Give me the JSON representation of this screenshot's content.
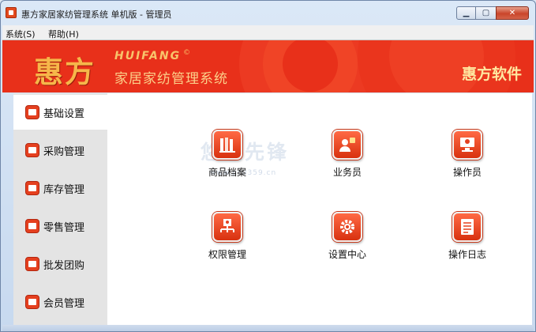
{
  "window": {
    "title": "惠方家居家纺管理系统 单机版 - 管理员",
    "controls": {
      "minimize": "▁",
      "maximize": "▢",
      "close": "✕"
    }
  },
  "menu": [
    {
      "label": "系统(S)"
    },
    {
      "label": "帮助(H)"
    }
  ],
  "banner": {
    "logo_cn": "惠方",
    "logo_en": "HUIFANG",
    "logo_reg": "©",
    "logo_sub": "家居家纺管理系统",
    "brand": "惠方软件"
  },
  "sidebar": {
    "items": [
      {
        "label": "基础设置",
        "icon": "list-icon",
        "active": true
      },
      {
        "label": "采购管理",
        "icon": "cart-icon",
        "active": false
      },
      {
        "label": "库存管理",
        "icon": "warehouse-icon",
        "active": false
      },
      {
        "label": "零售管理",
        "icon": "retail-icon",
        "active": false
      },
      {
        "label": "批发团购",
        "icon": "wholesale-icon",
        "active": false
      },
      {
        "label": "会员管理",
        "icon": "member-icon",
        "active": false
      }
    ]
  },
  "content": {
    "watermark": "悠悠先锋",
    "watermark_url": "www.pc0359.cn",
    "tiles": [
      {
        "label": "商品档案",
        "icon": "product-archive-icon"
      },
      {
        "label": "业务员",
        "icon": "salesman-icon"
      },
      {
        "label": "操作员",
        "icon": "operator-icon"
      },
      {
        "label": "权限管理",
        "icon": "permission-icon"
      },
      {
        "label": "设置中心",
        "icon": "settings-gear-icon"
      },
      {
        "label": "操作日志",
        "icon": "log-icon"
      }
    ]
  },
  "colors": {
    "banner_red": "#e8301a",
    "logo_gold": "#f6b74a",
    "icon_red": "#e5401f"
  }
}
